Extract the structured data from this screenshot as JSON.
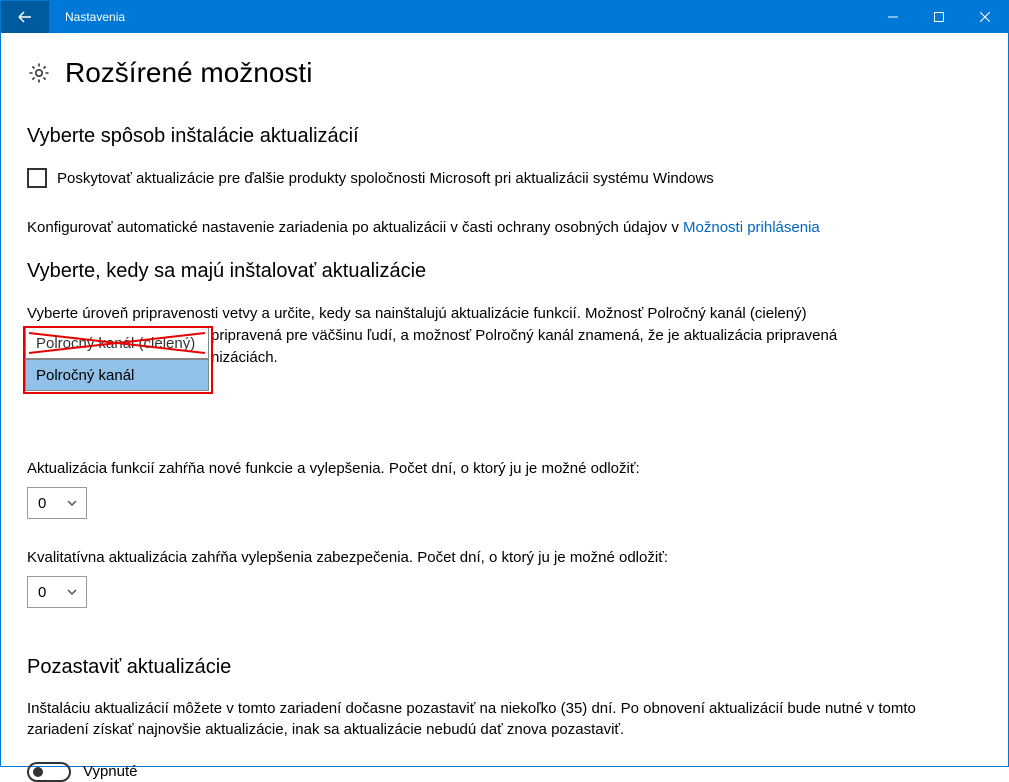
{
  "window": {
    "title": "Nastavenia"
  },
  "page": {
    "title": "Rozšírené možnosti"
  },
  "section_install": {
    "heading": "Vyberte spôsob inštalácie aktualizácií",
    "checkbox_label": "Poskytovať aktualizácie pre ďalšie produkty spoločnosti Microsoft pri aktualizácii systému Windows",
    "config_text_prefix": "Konfigurovať automatické nastavenie zariadenia po aktualizácii v časti ochrany osobných údajov v ",
    "config_link": "Možnosti prihlásenia"
  },
  "section_when": {
    "heading": "Vyberte, kedy sa majú inštalovať aktualizácie",
    "readiness_line1": "Vyberte úroveň pripravenosti vetvy a určite, kedy sa nainštalujú aktualizácie funkcií. Možnosť Polročný kanál (cielený)",
    "readiness_line2_mid": "pripravená pre väčšinu ľudí, a možnosť Polročný kanál znamená, že je aktualizácia pripravená",
    "readiness_line3_tail": "nizáciách.",
    "dropdown": {
      "option_struck": "Polročný kanál (cielený)",
      "option_selected": "Polročný kanál"
    },
    "feature_defer_label": "Aktualizácia funkcií zahŕňa nové funkcie a vylepšenia. Počet dní, o ktorý ju je možné odložiť:",
    "feature_defer_value": "0",
    "quality_defer_label": "Kvalitatívna aktualizácia zahŕňa vylepšenia zabezpečenia. Počet dní, o ktorý ju je možné odložiť:",
    "quality_defer_value": "0"
  },
  "section_pause": {
    "heading": "Pozastaviť aktualizácie",
    "body": "Inštaláciu aktualizácií môžete v tomto zariadení dočasne pozastaviť na niekoľko (35) dní. Po obnovení aktualizácií bude nutné v tomto zariadení získať najnovšie aktualizácie, inak sa aktualizácie nebudú dať znova pozastaviť.",
    "toggle_label": "Vypnuté"
  }
}
